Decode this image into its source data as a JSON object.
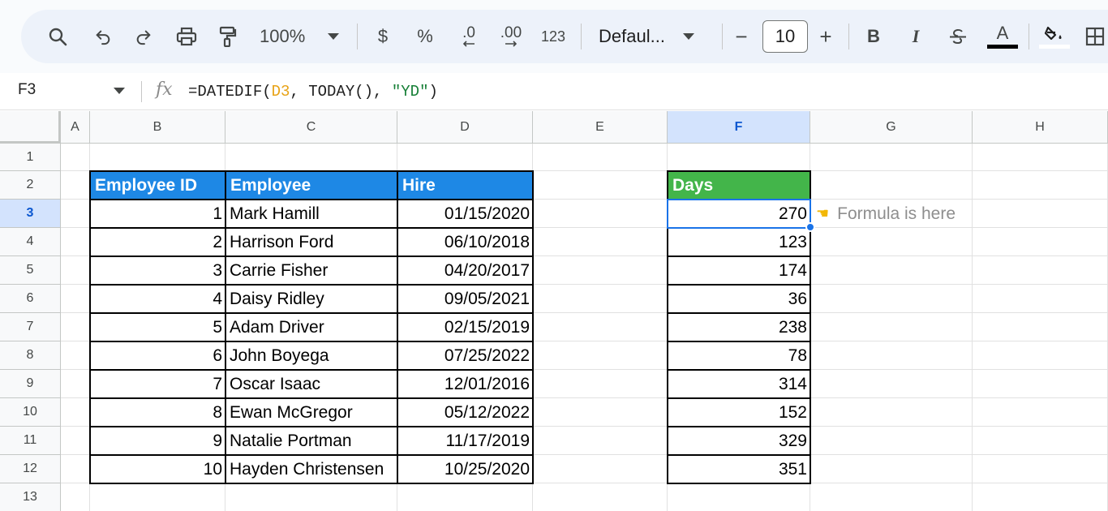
{
  "toolbar": {
    "zoom": "100%",
    "currency_label": "$",
    "percent_label": "%",
    "decrease_decimal_label": ".0",
    "increase_decimal_label": ".00",
    "number_format_label": "123",
    "font_name": "Defaul...",
    "font_size": "10",
    "minus_label": "−",
    "plus_label": "+",
    "bold_label": "B",
    "italic_label": "I",
    "text_color_label": "A",
    "text_color": "#000000"
  },
  "formula_bar": {
    "cell_ref": "F3",
    "fx_label": "fx",
    "formula_prefix": "=DATEDIF(",
    "formula_ref": "D3",
    "formula_middle": ", TODAY(), ",
    "formula_string": "\"YD\"",
    "formula_suffix": ")"
  },
  "columns": [
    "A",
    "B",
    "C",
    "D",
    "E",
    "F",
    "G",
    "H"
  ],
  "selected_column": "F",
  "rows": [
    "1",
    "2",
    "3",
    "4",
    "5",
    "6",
    "7",
    "8",
    "9",
    "10",
    "11",
    "12",
    "13"
  ],
  "selected_row": "3",
  "employee_table": {
    "headers": [
      "Employee ID",
      "Employee",
      "Hire"
    ],
    "header_color": "#1e88e5",
    "rows": [
      {
        "id": "1",
        "name": "Mark Hamill",
        "hire": "01/15/2020"
      },
      {
        "id": "2",
        "name": "Harrison Ford",
        "hire": "06/10/2018"
      },
      {
        "id": "3",
        "name": "Carrie Fisher",
        "hire": "04/20/2017"
      },
      {
        "id": "4",
        "name": "Daisy Ridley",
        "hire": "09/05/2021"
      },
      {
        "id": "5",
        "name": "Adam Driver",
        "hire": "02/15/2019"
      },
      {
        "id": "6",
        "name": "John Boyega",
        "hire": "07/25/2022"
      },
      {
        "id": "7",
        "name": "Oscar Isaac",
        "hire": "12/01/2016"
      },
      {
        "id": "8",
        "name": "Ewan McGregor",
        "hire": "05/12/2022"
      },
      {
        "id": "9",
        "name": "Natalie Portman",
        "hire": "11/17/2019"
      },
      {
        "id": "10",
        "name": "Hayden Christensen",
        "hire": "10/25/2020"
      }
    ]
  },
  "days_table": {
    "header": "Days",
    "header_color": "#43b54a",
    "values": [
      "270",
      "123",
      "174",
      "36",
      "238",
      "78",
      "314",
      "152",
      "329",
      "351"
    ]
  },
  "annotation": {
    "icon": "pointing-hand-icon",
    "text": "Formula is here"
  },
  "selection_color": "#1a73e8"
}
